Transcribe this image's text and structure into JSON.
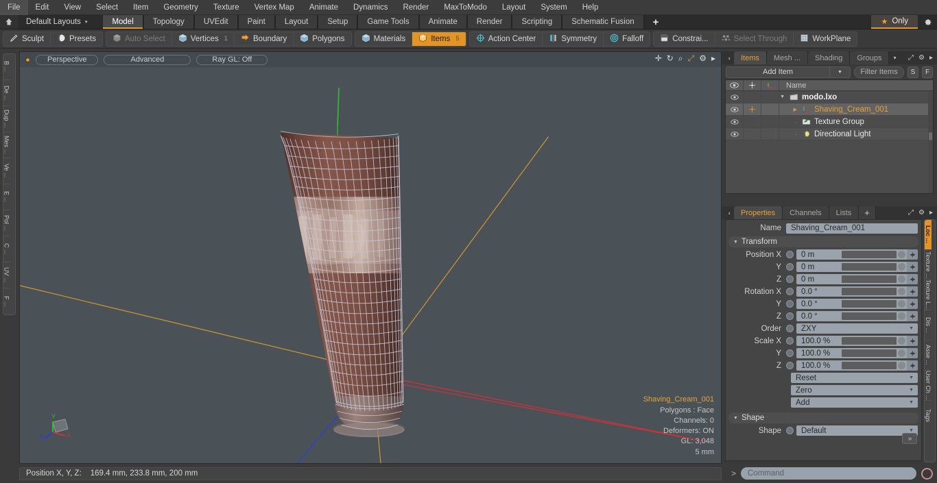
{
  "menubar": {
    "items": [
      "File",
      "Edit",
      "View",
      "Select",
      "Item",
      "Geometry",
      "Texture",
      "Vertex Map",
      "Animate",
      "Dynamics",
      "Render",
      "MaxToModo",
      "Layout",
      "System",
      "Help"
    ]
  },
  "layoutbar": {
    "home_icon": "home-icon",
    "layout_label": "Default Layouts",
    "caret": "▾",
    "tabs": [
      {
        "label": "Model",
        "active": true
      },
      {
        "label": "Topology",
        "active": false
      },
      {
        "label": "UVEdit",
        "active": false
      },
      {
        "label": "Paint",
        "active": false
      },
      {
        "label": "Layout",
        "active": false
      },
      {
        "label": "Setup",
        "active": false
      },
      {
        "label": "Game Tools",
        "active": false
      },
      {
        "label": "Animate",
        "active": false
      },
      {
        "label": "Render",
        "active": false
      },
      {
        "label": "Scripting",
        "active": false
      },
      {
        "label": "Schematic Fusion",
        "active": false
      }
    ],
    "plus": "+",
    "only_label": "Only",
    "only_star": "★",
    "gear_icon": "gear-icon"
  },
  "toolbar": {
    "group1": [
      {
        "label": "Sculpt",
        "icon": "pencil-icon",
        "state": "normal"
      },
      {
        "label": "Presets",
        "icon": "sphere-icon",
        "state": "normal"
      }
    ],
    "group2": [
      {
        "label": "Auto Select",
        "icon": "cube-gray-icon",
        "state": "dim",
        "count": ""
      },
      {
        "label": "Vertices",
        "icon": "cube-blue-icon",
        "state": "normal",
        "count": "1"
      },
      {
        "label": "Boundary",
        "icon": "boundary-icon",
        "state": "normal",
        "count": ""
      },
      {
        "label": "Polygons",
        "icon": "cube-blue-icon",
        "state": "normal",
        "count": ""
      }
    ],
    "group3": [
      {
        "label": "Materials",
        "icon": "cube-blue-icon",
        "state": "normal",
        "count": ""
      },
      {
        "label": "Items",
        "icon": "cube-orange-icon",
        "state": "selected",
        "count": "5"
      }
    ],
    "group4": [
      {
        "label": "Action Center",
        "icon": "crosshair-icon",
        "state": "normal"
      },
      {
        "label": "Symmetry",
        "icon": "symmetry-icon",
        "state": "normal"
      },
      {
        "label": "Falloff",
        "icon": "falloff-icon",
        "state": "normal"
      }
    ],
    "group5": [
      {
        "label": "Constrai...",
        "icon": "constraint-icon",
        "state": "normal"
      },
      {
        "label": "Select Through",
        "icon": "select-through-icon",
        "state": "dim"
      },
      {
        "label": "WorkPlane",
        "icon": "workplane-icon",
        "state": "normal"
      }
    ]
  },
  "left_rail": {
    "tabs": [
      "B ...",
      "De ...",
      "Dup ...",
      "Mes ...",
      "Ve ...",
      "E ...",
      "Pol ...",
      "C ...",
      "UV ...",
      "F ..."
    ]
  },
  "viewport": {
    "dot": "viewport-indicator",
    "pills": [
      "Perspective",
      "Advanced",
      "Ray GL: Off"
    ],
    "tools": [
      "move-icon",
      "rotate-icon",
      "zoom-icon",
      "fit-icon",
      "gear-icon",
      "play-icon"
    ],
    "info": {
      "selection": "Shaving_Cream_001",
      "polygons": "Polygons : Face",
      "channels": "Channels: 0",
      "deformers": "Deformers: ON",
      "gl": "GL: 3,048",
      "scale": "5 mm"
    },
    "axis_labels": {
      "x": "X",
      "y": "Y",
      "z": "Z"
    },
    "colors": {
      "background_top": "#4b545a",
      "background_bottom": "#3f474c",
      "wireframe": "#c9c6d4",
      "material": "#6f4a42",
      "axis_x": "#c8343a",
      "axis_y": "#2fbf2f",
      "axis_z": "#2b3fd0",
      "grid_line": "#d99b2c"
    }
  },
  "statusbar": {
    "label": "Position X, Y, Z:",
    "value": "169.4 mm, 233.8 mm, 200 mm"
  },
  "items_panel": {
    "tabs": [
      {
        "label": "Items",
        "active": true
      },
      {
        "label": "Mesh ...",
        "active": false
      },
      {
        "label": "Shading",
        "active": false
      },
      {
        "label": "Groups",
        "active": false
      }
    ],
    "add_item_label": "Add Item",
    "filter_placeholder": "Filter Items",
    "btn_s": "S",
    "btn_f": "F",
    "columns": {
      "eye": "eye-icon",
      "move": "move-icon",
      "axis": "axis-icon",
      "name": "Name"
    },
    "rows": [
      {
        "name": "modo.lxo",
        "icon": "scene-icon",
        "depth": 0,
        "root": true,
        "selected": false,
        "expander": "▼"
      },
      {
        "name": "Shaving_Cream_001",
        "icon": "mesh-icon",
        "depth": 1,
        "root": false,
        "selected": true,
        "expander": "▶"
      },
      {
        "name": "Texture Group",
        "icon": "texture-group-icon",
        "depth": 1,
        "root": false,
        "selected": false,
        "expander": ""
      },
      {
        "name": "Directional Light",
        "icon": "light-icon",
        "depth": 1,
        "root": false,
        "selected": false,
        "expander": ""
      }
    ]
  },
  "properties_panel": {
    "tabs": [
      {
        "label": "Properties",
        "active": true
      },
      {
        "label": "Channels",
        "active": false
      },
      {
        "label": "Lists",
        "active": false
      },
      {
        "label": "+",
        "active": false
      }
    ],
    "name_label": "Name",
    "name_value": "Shaving_Cream_001",
    "transform_header": "Transform",
    "fields": [
      {
        "label": "Position X",
        "value": "0 m",
        "type": "num"
      },
      {
        "label": "Y",
        "value": "0 m",
        "type": "num"
      },
      {
        "label": "Z",
        "value": "0 m",
        "type": "num"
      },
      {
        "label": "Rotation X",
        "value": "0.0 °",
        "type": "num"
      },
      {
        "label": "Y",
        "value": "0.0 °",
        "type": "num"
      },
      {
        "label": "Z",
        "value": "0.0 °",
        "type": "num"
      },
      {
        "label": "Order",
        "value": "ZXY",
        "type": "dropdown"
      },
      {
        "label": "Scale X",
        "value": "100.0 %",
        "type": "num"
      },
      {
        "label": "Y",
        "value": "100.0 %",
        "type": "num"
      },
      {
        "label": "Z",
        "value": "100.0 %",
        "type": "num"
      }
    ],
    "actions": [
      "Reset",
      "Zero",
      "Add"
    ],
    "shape_header": "Shape",
    "shape_label": "Shape",
    "shape_value": "Default",
    "more_button": "»"
  },
  "right_rail": {
    "tabs": [
      {
        "label": "Loc ...",
        "active": true
      },
      {
        "label": "Texture ...",
        "active": false
      },
      {
        "label": "Texture L...",
        "active": false
      },
      {
        "label": "Dis ...",
        "active": false
      },
      {
        "label": "Asse ...",
        "active": false
      },
      {
        "label": "User Ch ...",
        "active": false
      },
      {
        "label": "Tags",
        "active": false
      }
    ]
  },
  "command_bar": {
    "prompt": ">",
    "placeholder": "Command",
    "record_icon": "record-icon"
  }
}
